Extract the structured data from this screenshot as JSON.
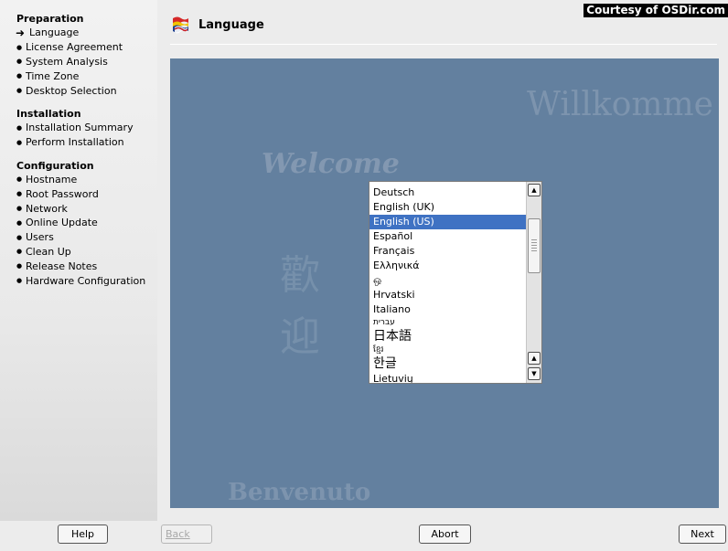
{
  "watermark": "Courtesy of OSDir.com",
  "header": {
    "title": "Language",
    "icon": "flags-icon"
  },
  "sidebar": {
    "sections": [
      {
        "heading": "Preparation",
        "items": [
          {
            "label": "Language",
            "current": true
          },
          {
            "label": "License Agreement"
          },
          {
            "label": "System Analysis"
          },
          {
            "label": "Time Zone"
          },
          {
            "label": "Desktop Selection"
          }
        ]
      },
      {
        "heading": "Installation",
        "items": [
          {
            "label": "Installation Summary"
          },
          {
            "label": "Perform Installation"
          }
        ]
      },
      {
        "heading": "Configuration",
        "items": [
          {
            "label": "Hostname"
          },
          {
            "label": "Root Password"
          },
          {
            "label": "Network"
          },
          {
            "label": "Online Update"
          },
          {
            "label": "Users"
          },
          {
            "label": "Clean Up"
          },
          {
            "label": "Release Notes"
          },
          {
            "label": "Hardware Configuration"
          }
        ]
      }
    ]
  },
  "background_text": {
    "willkommen": "Willkomme",
    "welcome": "Welcome",
    "kanji_1": "歡",
    "kanji_2": "迎",
    "benvenuto": "Benvenuto"
  },
  "language_list": {
    "selected": "English (US)",
    "items": [
      "Deutsch",
      "English (UK)",
      "English (US)",
      "Español",
      "Français",
      "Ελληνικά",
      "ஒ",
      "Hrvatski",
      "Italiano",
      "עברית",
      "日本語",
      "ខ្មែរ",
      "한글",
      "Lietuvių"
    ]
  },
  "buttons": {
    "help": "Help",
    "back": "Back",
    "abort": "Abort",
    "next": "Next"
  },
  "colors": {
    "panel_background": "#63809f",
    "selection": "#3f72c3"
  }
}
